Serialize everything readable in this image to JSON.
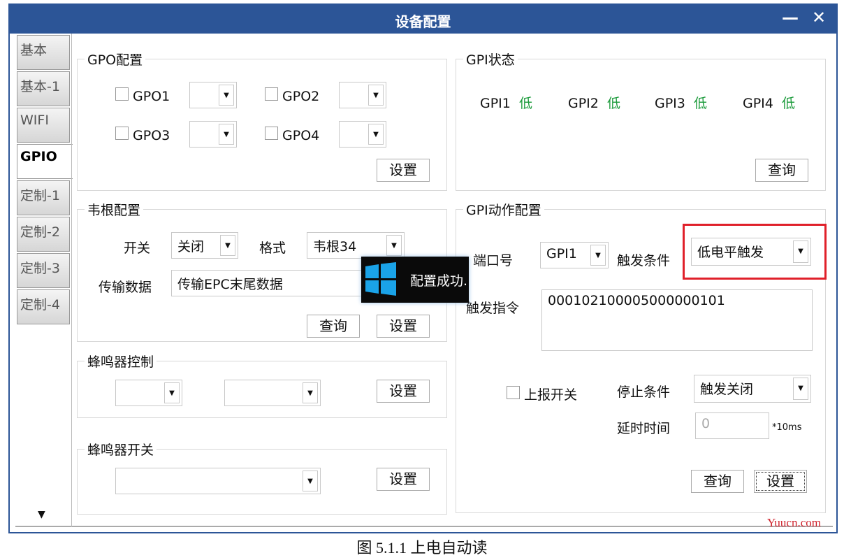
{
  "window": {
    "title": "设备配置",
    "minimize": "—",
    "close": "✕"
  },
  "tabs": [
    {
      "label": "基本"
    },
    {
      "label": "基本-1"
    },
    {
      "label": "WIFI"
    },
    {
      "label": "GPIO"
    },
    {
      "label": "定制-1"
    },
    {
      "label": "定制-2"
    },
    {
      "label": "定制-3"
    },
    {
      "label": "定制-4"
    }
  ],
  "gpo": {
    "title": "GPO配置",
    "items": [
      {
        "label": "GPO1",
        "value": ""
      },
      {
        "label": "GPO2",
        "value": ""
      },
      {
        "label": "GPO3",
        "value": ""
      },
      {
        "label": "GPO4",
        "value": ""
      }
    ],
    "set": "设置"
  },
  "gpi_status": {
    "title": "GPI状态",
    "items": [
      {
        "label": "GPI1",
        "state": "低"
      },
      {
        "label": "GPI2",
        "state": "低"
      },
      {
        "label": "GPI3",
        "state": "低"
      },
      {
        "label": "GPI4",
        "state": "低"
      }
    ],
    "query": "查询",
    "state_color": "#1a9a3a"
  },
  "wiegand": {
    "title": "韦根配置",
    "switch_label": "开关",
    "switch_value": "关闭",
    "format_label": "格式",
    "format_value": "韦根34",
    "data_label": "传输数据",
    "data_value": "传输EPC末尾数据",
    "query": "查询",
    "set": "设置"
  },
  "buzzer_ctrl": {
    "title": "蜂鸣器控制",
    "set": "设置"
  },
  "buzzer_switch": {
    "title": "蜂鸣器开关",
    "set": "设置"
  },
  "gpi_action": {
    "title": "GPI动作配置",
    "port_label": "端口号",
    "port_value": "GPI1",
    "trigger_label": "触发条件",
    "trigger_value": "低电平触发",
    "cmd_label": "触发指令",
    "cmd_value": "000102100005000000101",
    "report_label": "上报开关",
    "stop_label": "停止条件",
    "stop_value": "触发关闭",
    "delay_label": "延时时间",
    "delay_value": "0",
    "delay_unit": "*10ms",
    "query": "查询",
    "set": "设置",
    "highlight_color": "#e0202a"
  },
  "toast": {
    "message": "配置成功."
  },
  "watermark": "Yuucn.com",
  "caption": "图 5.1.1  上电自动读"
}
